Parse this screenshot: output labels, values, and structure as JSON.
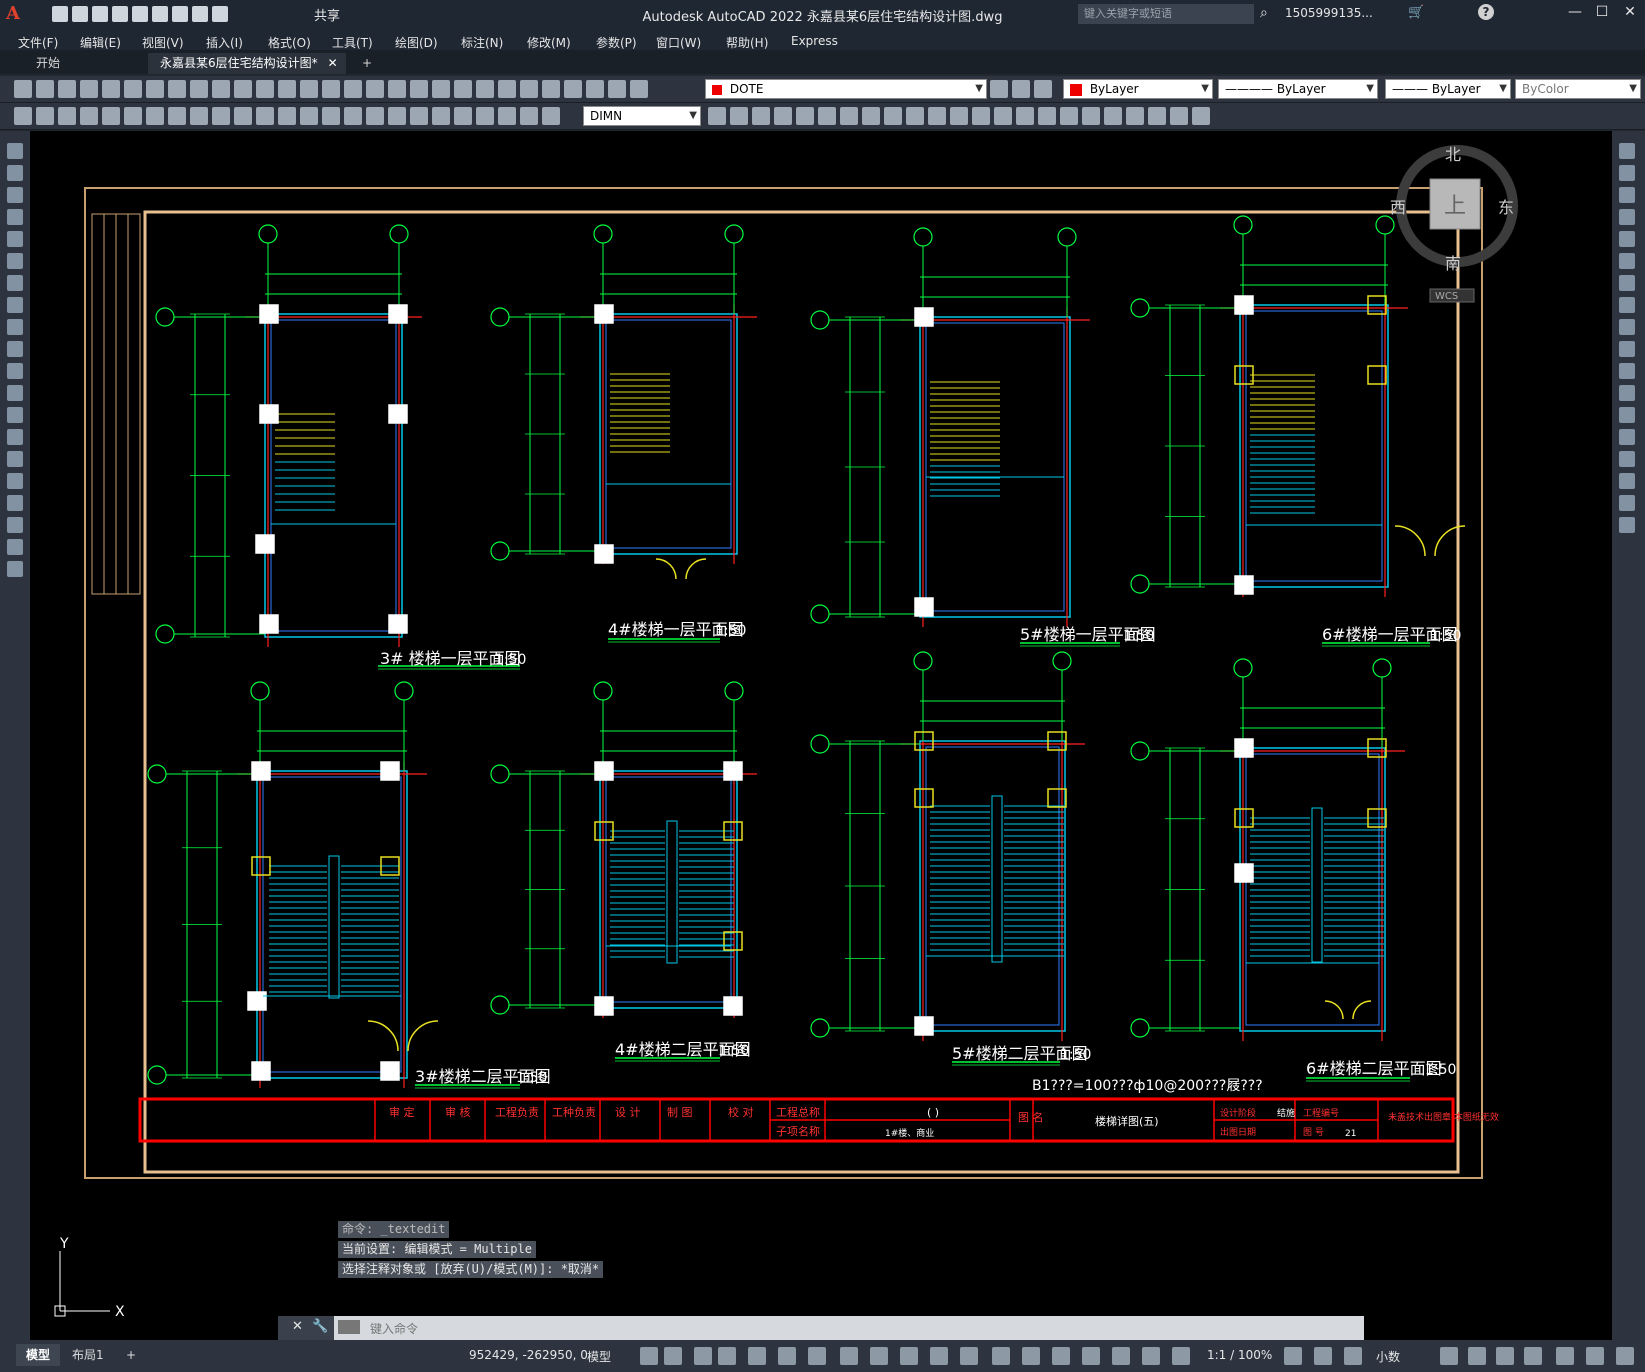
{
  "app": {
    "logo": "A",
    "title": "Autodesk AutoCAD 2022    永嘉县某6层住宅结构设计图.dwg",
    "share_label": "共享",
    "search_placeholder": "键入关键字或短语",
    "user": "1505999135...",
    "window_controls": {
      "minimize": "—",
      "maximize": "☐",
      "close": "✕"
    }
  },
  "menu": [
    "文件(F)",
    "编辑(E)",
    "视图(V)",
    "插入(I)",
    "格式(O)",
    "工具(T)",
    "绘图(D)",
    "标注(N)",
    "修改(M)",
    "参数(P)",
    "窗口(W)",
    "帮助(H)",
    "Express"
  ],
  "tabs": {
    "start": "开始",
    "active": "永嘉县某6层住宅结构设计图*",
    "close": "✕",
    "new": "+"
  },
  "toolbar": {
    "layer": "DOTE",
    "color": "ByLayer",
    "linetype": "ByLayer",
    "lineweight": "ByLayer",
    "plotstyle": "ByColor",
    "dimstyle": "DIMN"
  },
  "viewcube": {
    "north": "北",
    "south": "南",
    "east": "东",
    "west": "西",
    "top": "上",
    "wcs": "WCS"
  },
  "drawing": {
    "plans": [
      {
        "title": "3#  楼梯一层平面图",
        "scale": "1:50"
      },
      {
        "title": "4#楼梯一层平面图",
        "scale": "1:50"
      },
      {
        "title": "5#楼梯一层平面图",
        "scale": "1:50"
      },
      {
        "title": "6#楼梯一层平面图",
        "scale": "1:50"
      },
      {
        "title": "3#楼梯二层平面图",
        "scale": "1:50"
      },
      {
        "title": "4#楼梯二层平面图",
        "scale": "1:50"
      },
      {
        "title": "5#楼梯二层平面图",
        "scale": "1:50"
      },
      {
        "title": "6#楼梯二层平面图",
        "scale": "1:50"
      }
    ],
    "note": "B1???=100???ф10@200???屐???",
    "titleblock": {
      "cells": [
        "审 定",
        "审 核",
        "工程负责",
        "工种负责",
        "设 计",
        "制 图",
        "校 对",
        "工程总称",
        "子项名称"
      ],
      "project_value": "(                )",
      "subitem_value": "1#楼、商业",
      "drawing_label": "图 名",
      "drawing_name": "楼梯详图(五)",
      "stage_label": "设计阶段",
      "stage_value": "结施",
      "date_label": "出图日期",
      "job_label": "工程编号",
      "sheet_label": "图 号",
      "sheet_value": "21",
      "warning": "未盖技术出图章 本图纸无效"
    }
  },
  "command": {
    "history": [
      "命令: _textedit",
      "当前设置: 编辑模式 = Multiple",
      "选择注释对象或 [放弃(U)/模式(M)]: *取消*"
    ],
    "placeholder": "键入命令"
  },
  "status": {
    "model_tab": "模型",
    "layout_tab": "布局1",
    "add": "+",
    "coords": "952429, -262950, 0",
    "space": "模型",
    "scale": "1:1 / 100%",
    "units": "小数"
  },
  "ucs": {
    "x": "X",
    "y": "Y"
  }
}
